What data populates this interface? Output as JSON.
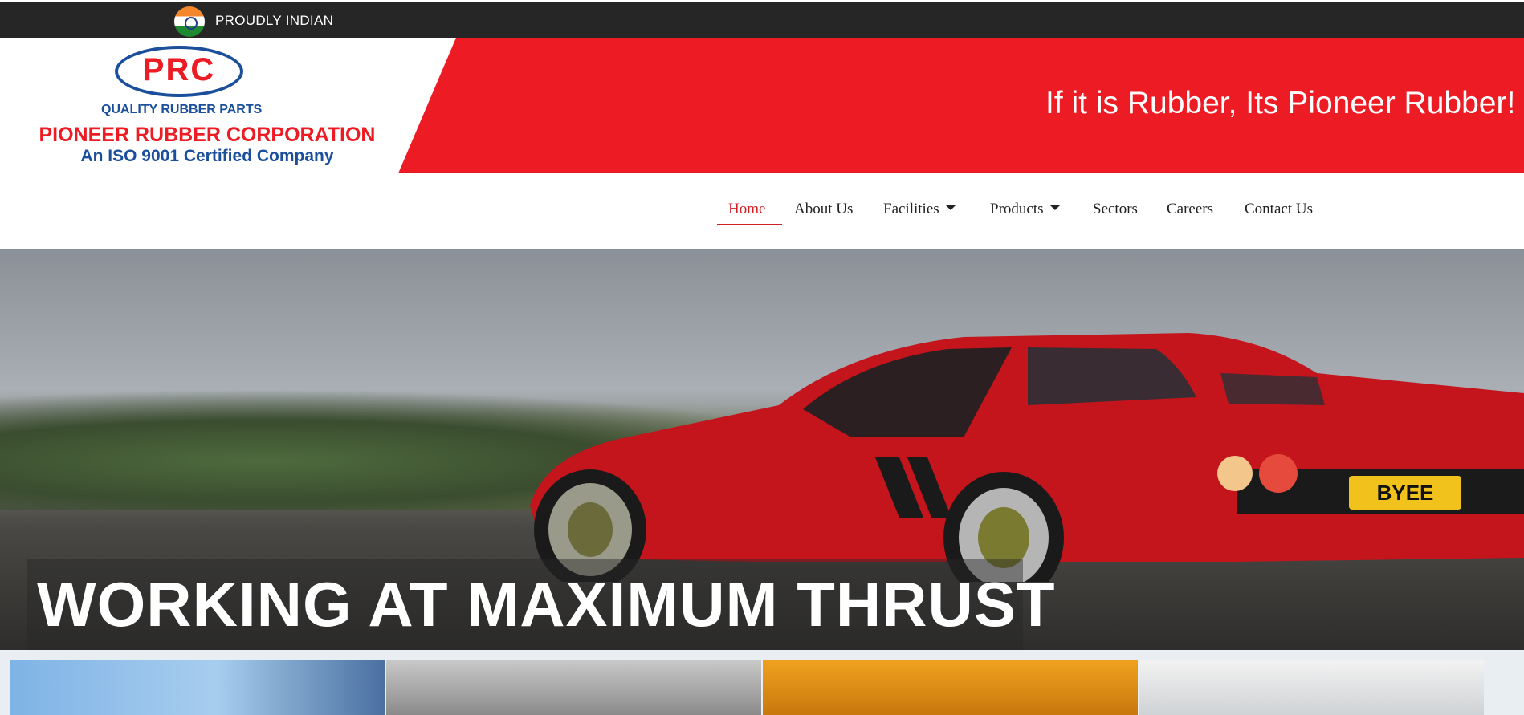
{
  "topbar": {
    "tagline": "PROUDLY INDIAN",
    "flag_icon": "india-flag-icon"
  },
  "logo": {
    "mark": "PRC",
    "quality": "QUALITY RUBBER PARTS",
    "company": "PIONEER RUBBER CORPORATION",
    "certification": "An ISO 9001 Certified Company"
  },
  "banner": {
    "slogan": "If it is Rubber, Its Pioneer Rubber!"
  },
  "nav": {
    "items": [
      {
        "label": "Home",
        "active": true
      },
      {
        "label": "About Us"
      },
      {
        "label": "Facilities",
        "dropdown": true
      },
      {
        "label": "Products",
        "dropdown": true
      },
      {
        "label": "Sectors"
      },
      {
        "label": "Careers"
      },
      {
        "label": "Contact Us"
      }
    ]
  },
  "hero": {
    "caption": "WORKING AT MAXIMUM THRUST",
    "plate": "BYEE"
  },
  "colors": {
    "brand_red": "#ed1c24",
    "brand_blue": "#1b4f9c",
    "topbar": "#262626",
    "active_nav": "#cf1f25"
  }
}
